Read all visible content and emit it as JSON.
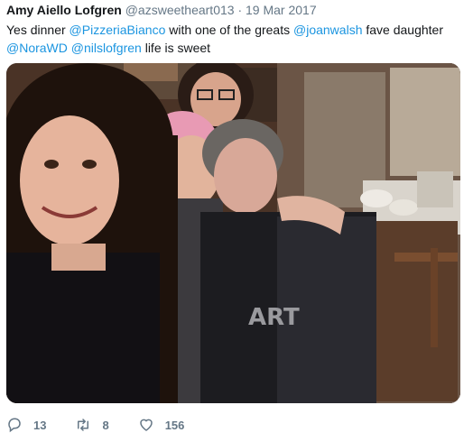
{
  "tweet": {
    "display_name": "Amy Aiello Lofgren",
    "handle": "@azsweetheart013",
    "separator": "·",
    "date": "19 Mar 2017",
    "text": {
      "part1": "Yes dinner ",
      "mention1": "@PizzeriaBianco",
      "part2": " with one of the greats ",
      "mention2": "@joanwalsh",
      "part3": " fave daughter",
      "mention3": "@NoraWD",
      "part4": " ",
      "mention4": "@nilslofgren",
      "part5": " life is sweet"
    }
  },
  "actions": {
    "reply_count": "13",
    "retweet_count": "8",
    "like_count": "156",
    "reply_icon": "reply-icon",
    "retweet_icon": "retweet-icon",
    "like_icon": "heart-icon"
  },
  "colors": {
    "link": "#1b95e0",
    "secondary": "#657786",
    "primary": "#14171a"
  }
}
